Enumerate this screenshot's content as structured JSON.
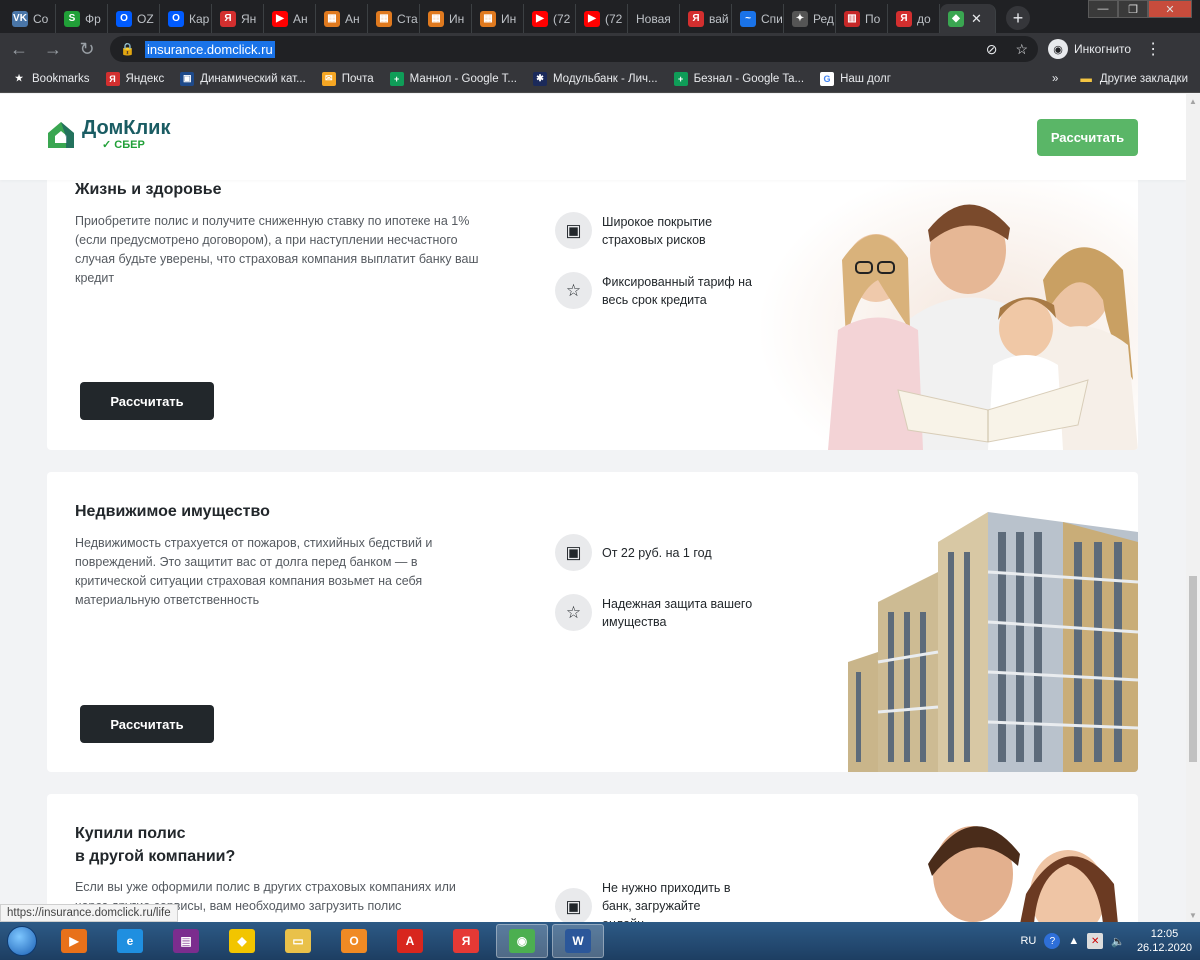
{
  "browser": {
    "tabs": [
      {
        "label": "Со",
        "icon": "vk-icon",
        "color": "#4a76a8",
        "glyph": "VK"
      },
      {
        "label": "Фр",
        "icon": "sber-icon",
        "color": "#21a038",
        "glyph": "S"
      },
      {
        "label": "OZ",
        "icon": "ozon-icon",
        "color": "#005bff",
        "glyph": "O"
      },
      {
        "label": "Кар",
        "icon": "ozon-icon",
        "color": "#005bff",
        "glyph": "O"
      },
      {
        "label": "Ян",
        "icon": "yandex-icon",
        "color": "#d32f2f",
        "glyph": "Я"
      },
      {
        "label": "Ан",
        "icon": "youtube-icon",
        "color": "#ff0000",
        "glyph": "▶"
      },
      {
        "label": "Ан",
        "icon": "sheet-icon",
        "color": "#e07a1f",
        "glyph": "▦"
      },
      {
        "label": "Ста",
        "icon": "sheet-icon",
        "color": "#e07a1f",
        "glyph": "▦"
      },
      {
        "label": "Ин",
        "icon": "sheet-icon",
        "color": "#e07a1f",
        "glyph": "▦"
      },
      {
        "label": "Ин",
        "icon": "sheet-icon",
        "color": "#e07a1f",
        "glyph": "▦"
      },
      {
        "label": "(72",
        "icon": "youtube-icon",
        "color": "#ff0000",
        "glyph": "▶"
      },
      {
        "label": "(72",
        "icon": "youtube-icon",
        "color": "#ff0000",
        "glyph": "▶"
      },
      {
        "label": "Новая",
        "icon": "",
        "color": "",
        "glyph": ""
      },
      {
        "label": "вай",
        "icon": "yandex-icon",
        "color": "#d32f2f",
        "glyph": "Я"
      },
      {
        "label": "Спи",
        "icon": "link-icon",
        "color": "#1a73e8",
        "glyph": "~"
      },
      {
        "label": "Ред",
        "icon": "sparkle-icon",
        "color": "#555555",
        "glyph": "✦"
      },
      {
        "label": "По",
        "icon": "chart-icon",
        "color": "#c62828",
        "glyph": "▥"
      },
      {
        "label": "до",
        "icon": "yandex-icon",
        "color": "#d32f2f",
        "glyph": "Я"
      }
    ],
    "active_tab_icon_color": "#3aa651",
    "url": "insurance.domclick.ru",
    "incognito_label": "Инкогнито",
    "bookmarks": [
      {
        "label": "Bookmarks",
        "icon": "star-icon",
        "color": "#35363a",
        "glyph": "★"
      },
      {
        "label": "Яндекс",
        "icon": "yandex-icon",
        "color": "#d32f2f",
        "glyph": "Я"
      },
      {
        "label": "Динамический кат...",
        "icon": "catalog-icon",
        "color": "#1e4a8a",
        "glyph": "▣"
      },
      {
        "label": "Почта",
        "icon": "mail-icon",
        "color": "#f5a623",
        "glyph": "✉"
      },
      {
        "label": "Маннол - Google T...",
        "icon": "sheets-icon",
        "color": "#0f9d58",
        "glyph": "+"
      },
      {
        "label": "Модульбанк - Лич...",
        "icon": "modulbank-icon",
        "color": "#1b2a5a",
        "glyph": "✱"
      },
      {
        "label": "Безнал - Google Ta...",
        "icon": "sheets-icon",
        "color": "#0f9d58",
        "glyph": "+"
      },
      {
        "label": "Наш долг",
        "icon": "google-icon",
        "color": "#ffffff",
        "glyph": "G"
      }
    ],
    "other_bookmarks": "Другие закладки",
    "status_url": "https://insurance.domclick.ru/life"
  },
  "header": {
    "logo_text": "ДомКлик",
    "logo_sub": "СБЕР",
    "button": "Рассчитать"
  },
  "cards": [
    {
      "title": "Жизнь и здоровье",
      "description": "Приобретите полис и получите сниженную ставку по ипотеке на 1% (если предусмотрено договором), а при наступлении несчастного случая будьте уверены, что страховая компания выплатит банку ваш кредит",
      "features": [
        {
          "icon": "money-icon",
          "text": "Широкое покрытие страховых рисков"
        },
        {
          "icon": "star-icon",
          "text": "Фиксированный тариф на весь срок кредита"
        }
      ],
      "button": "Рассчитать"
    },
    {
      "title": "Недвижимое имущество",
      "description": "Недвижимость страхуется от пожаров, стихийных бедствий и повреждений. Это защитит вас от долга перед банком — в критической ситуации страховая компания возьмет на себя материальную ответственность",
      "features": [
        {
          "icon": "money-icon",
          "text": "От 22 руб. на 1 год"
        },
        {
          "icon": "star-icon",
          "text": "Надежная защита вашего имущества"
        }
      ],
      "button": "Рассчитать"
    },
    {
      "title_line1": "Купили полис",
      "title_line2": "в другой компании?",
      "description": "Если вы уже оформили полис в других страховых компаниях или через другие сервисы, вам необходимо загрузить полис",
      "features": [
        {
          "icon": "money-icon",
          "text": "Не нужно приходить в банк, загружайте онлайн"
        }
      ]
    }
  ],
  "taskbar": {
    "apps": [
      {
        "icon": "media-player-icon",
        "color": "#e8711a",
        "glyph": "▶"
      },
      {
        "icon": "ie-icon",
        "color": "#1f8fe0",
        "glyph": "e"
      },
      {
        "icon": "winrar-icon",
        "color": "#7b2d8e",
        "glyph": "▤"
      },
      {
        "icon": "batman-icon",
        "color": "#f2c500",
        "glyph": "◆"
      },
      {
        "icon": "explorer-icon",
        "color": "#e9c14a",
        "glyph": "▭"
      },
      {
        "icon": "outlook-icon",
        "color": "#f08a24",
        "glyph": "O"
      },
      {
        "icon": "acrobat-icon",
        "color": "#d8261d",
        "glyph": "A"
      },
      {
        "icon": "yandex-browser-icon",
        "color": "#e53935",
        "glyph": "Я"
      },
      {
        "icon": "chrome-icon",
        "color": "#4caf50",
        "glyph": "◉"
      },
      {
        "icon": "word-icon",
        "color": "#2b579a",
        "glyph": "W"
      }
    ],
    "lang": "RU",
    "time": "12:05",
    "date": "26.12.2020"
  }
}
